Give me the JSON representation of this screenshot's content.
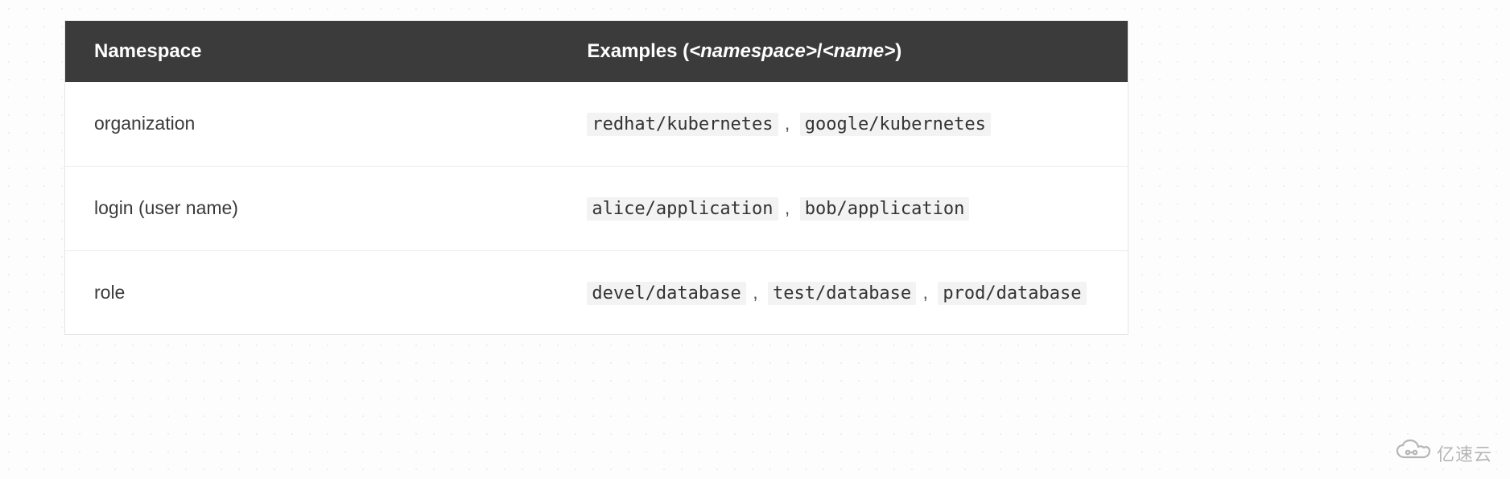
{
  "table": {
    "headers": {
      "namespace": "Namespace",
      "examples_prefix": "Examples (",
      "examples_ns": "<namespace>",
      "examples_slash": "/",
      "examples_name": "<name>",
      "examples_suffix": ")"
    },
    "rows": [
      {
        "namespace": "organization",
        "examples": [
          "redhat/kubernetes",
          "google/kubernetes"
        ]
      },
      {
        "namespace": "login (user name)",
        "examples": [
          "alice/application",
          "bob/application"
        ]
      },
      {
        "namespace": "role",
        "examples": [
          "devel/database",
          "test/database",
          "prod/database"
        ]
      }
    ]
  },
  "watermark": {
    "text": "亿速云"
  }
}
